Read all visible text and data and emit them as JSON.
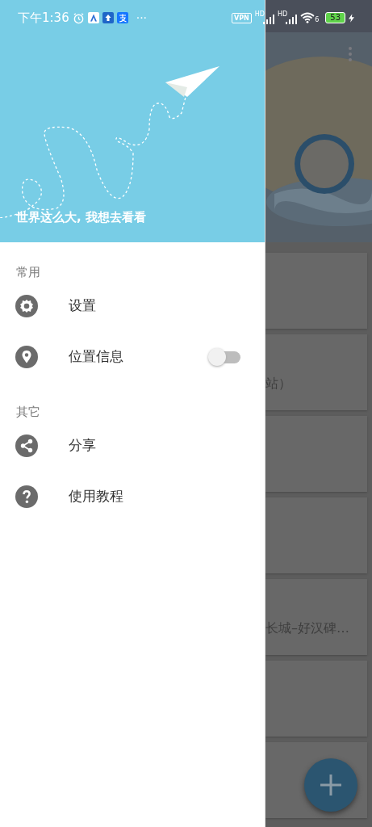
{
  "status_bar": {
    "time": "下午1:36",
    "more": "···",
    "vpn": "VPN",
    "signal_badges": [
      "HD",
      "HD"
    ],
    "wifi_badge": "6",
    "battery": "53"
  },
  "drawer": {
    "header_title": "世界这么大, 我想去看看",
    "sections": [
      {
        "title": "常用",
        "items": [
          {
            "kind": "link",
            "label": "设置"
          },
          {
            "kind": "switch",
            "label": "位置信息",
            "on": false
          }
        ]
      },
      {
        "title": "其它",
        "items": [
          {
            "kind": "link",
            "label": "分享"
          },
          {
            "kind": "link",
            "label": "使用教程"
          }
        ]
      }
    ]
  },
  "background": {
    "cards": [
      {
        "kind": "blank"
      },
      {
        "kind": "text",
        "text": "站）"
      },
      {
        "kind": "blank"
      },
      {
        "kind": "blank"
      },
      {
        "kind": "text",
        "text": "长城–好汉碑…"
      },
      {
        "kind": "blank"
      },
      {
        "kind": "blank"
      }
    ]
  }
}
